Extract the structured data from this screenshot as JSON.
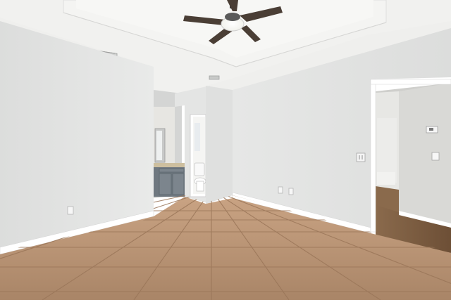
{
  "scene": {
    "kind": "empty bedroom with tile floor",
    "colors": {
      "wall_left": "#e4e5e4",
      "wall_back": "#e0e1e0",
      "ceiling": "#f0f0ee",
      "tile": "#b08c6c",
      "grout": "#9a7659",
      "baseboard": "#ffffff",
      "vanity": "#6f7880",
      "countertop": "#cdbf9f",
      "hall_floor": "#7a5a3e",
      "fan_blade": "#4a3e35"
    },
    "features": [
      "ceiling-fan",
      "tray-ceiling",
      "hvac-vent",
      "bathroom-doorway",
      "bathroom-vanity",
      "toilet",
      "hallway-doorway",
      "thermostat",
      "light-switch",
      "outlets"
    ]
  }
}
